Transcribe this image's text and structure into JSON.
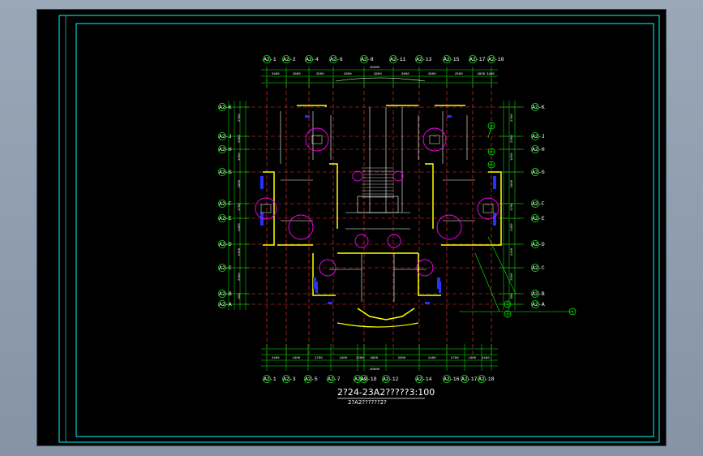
{
  "drawing": {
    "title": "2?24-23A2?????3:100",
    "subtitle": "2?A2??????2?",
    "colors": {
      "background": "#000000",
      "frame": "#00ffff",
      "grid": "#ff3333",
      "dimension": "#00ff00",
      "walls": "#ffff00",
      "columns": "#2233ff",
      "fixtures": "#ff00ff",
      "detail": "#ffffff"
    },
    "top_axes": [
      "A2-1",
      "A2-2",
      "A2-4",
      "A2-6",
      "A2-8",
      "A2-11",
      "A2-13",
      "A2-15",
      "A2-17",
      "A2-18"
    ],
    "bottom_axes": [
      "A2-1",
      "A2-3",
      "A2-5",
      "A2-7",
      "A2-9",
      "A2-10",
      "A2-12",
      "A2-14",
      "A2-16",
      "A2-17",
      "A2-18"
    ],
    "left_axes": [
      "A2-K",
      "A2-J",
      "A2-H",
      "A2-G",
      "A2-F",
      "A2-E",
      "A2-D",
      "A2-C",
      "A2-B",
      "A2-A"
    ],
    "right_axes": [
      "A2-K",
      "A2-J",
      "A2-H",
      "A2-G",
      "A2-F",
      "A2-E",
      "A2-D",
      "A2-C",
      "A2-B",
      "A2-A"
    ],
    "top_dims": [
      "3400",
      "2600",
      "2500",
      "2600",
      "3800",
      "3800",
      "2600",
      "2500",
      "2600",
      "3400"
    ],
    "top_total": "40000",
    "bottom_dims": [
      "2400",
      "1300",
      "2700",
      "2400",
      "3200",
      "3800",
      "3200",
      "2400",
      "2700",
      "1300",
      "2400"
    ],
    "bottom_total": "40000",
    "left_dims": [
      "2700",
      "2300",
      "1500",
      "2900",
      "1700",
      "2400",
      "2100",
      "2500",
      "900"
    ],
    "right_dims": [
      "2700",
      "2300",
      "1500",
      "2900",
      "1700",
      "2400",
      "2100",
      "2500",
      "900"
    ]
  }
}
